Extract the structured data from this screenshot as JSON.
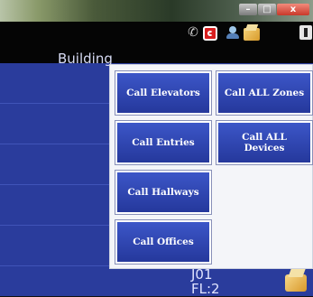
{
  "os_window": {
    "minimize_glyph": "–",
    "maximize_glyph": "□",
    "close_glyph": "x"
  },
  "toolbar": {
    "icons": [
      "phone-icon",
      "red-circle-icon",
      "person-icon",
      "box-icon",
      "scroll-icon"
    ],
    "phone_glyph": "✆"
  },
  "list": {
    "row_label": "Building",
    "bottom_lines": [
      "J01",
      "FL:2"
    ]
  },
  "call_menu": {
    "buttons": [
      {
        "label": "Call Elevators"
      },
      {
        "label": "Call ALL Zones"
      },
      {
        "label": "Call Entries"
      },
      {
        "label": "Call ALL Devices"
      },
      {
        "label": "Call Hallways"
      },
      {
        "label": "Call Offices"
      }
    ]
  },
  "colors": {
    "accent_blue": "#2a3c9c",
    "button_blue": "#3c56c8",
    "panel_bg": "#f4f5f9"
  }
}
